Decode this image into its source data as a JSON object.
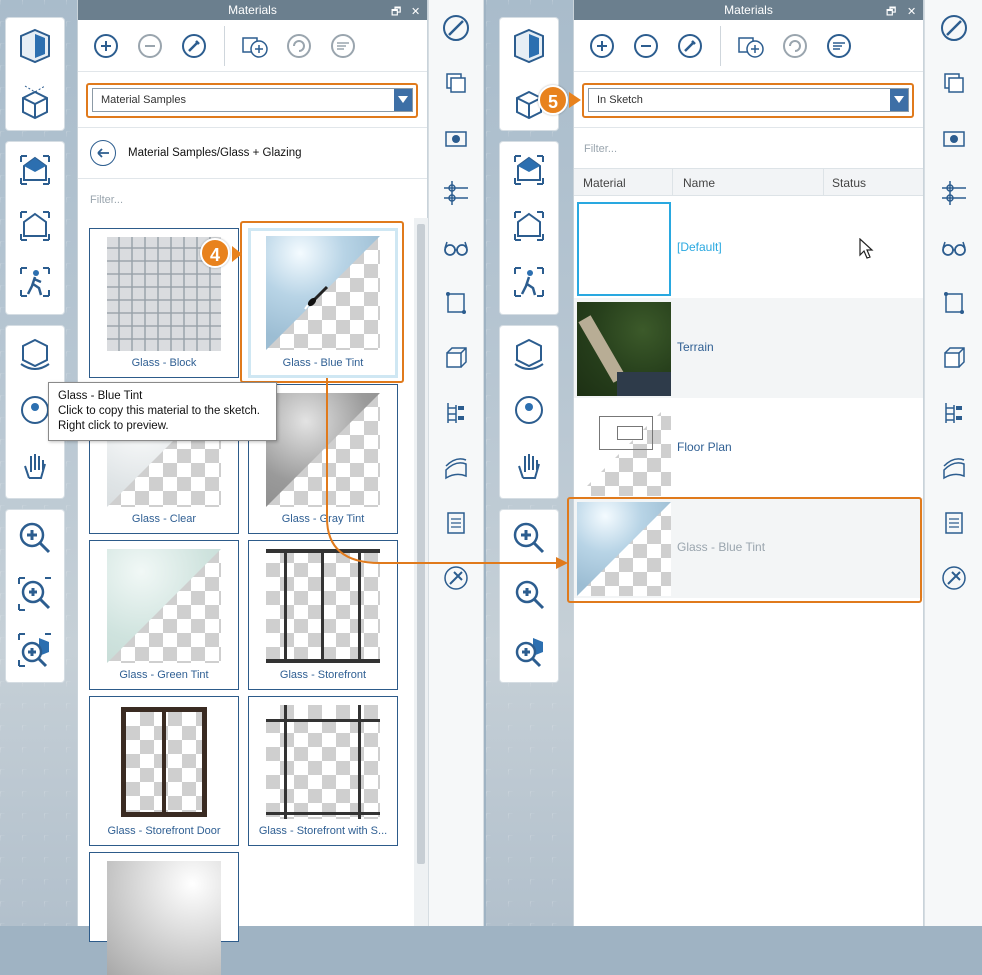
{
  "left_panel": {
    "title": "Materials",
    "library_select": {
      "value": "Material Samples"
    },
    "breadcrumb": "Material Samples/Glass + Glazing",
    "filter_placeholder": "Filter...",
    "tiles": [
      {
        "label": "Glass - Block"
      },
      {
        "label": "Glass - Blue Tint"
      },
      {
        "label": "Glass - Clear"
      },
      {
        "label": "Glass - Gray Tint"
      },
      {
        "label": "Glass - Green Tint"
      },
      {
        "label": "Glass - Storefront"
      },
      {
        "label": "Glass - Storefront Door"
      },
      {
        "label": "Glass - Storefront with S..."
      },
      {
        "label": ""
      }
    ],
    "tooltip": {
      "line1": "Glass - Blue Tint",
      "line2": "Click to copy this material to the sketch.",
      "line3": "Right click to preview."
    }
  },
  "right_panel": {
    "title": "Materials",
    "sketch_select": {
      "value": "In Sketch"
    },
    "filter_placeholder": "Filter...",
    "columns": [
      "Material",
      "Name",
      "Status"
    ],
    "rows": [
      {
        "name": "[Default]"
      },
      {
        "name": "Terrain"
      },
      {
        "name": "Floor Plan"
      },
      {
        "name": "Glass - Blue Tint"
      }
    ]
  },
  "callouts": {
    "step4": "4",
    "step5": "5"
  },
  "colors": {
    "accent": "#e07a1c",
    "titlebar": "#6b7f8e",
    "link": "#2f5f93",
    "selected": "#29a8e0"
  }
}
